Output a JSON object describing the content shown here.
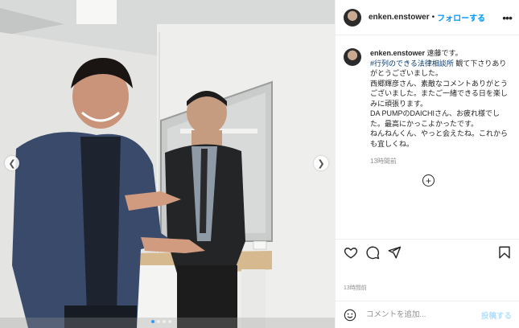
{
  "post": {
    "username": "enken.enstower",
    "separator": "•",
    "follow_label": "フォローする",
    "more_icon": "more-options-icon",
    "caption": {
      "username": "enken.enstower",
      "line1": "遠藤です。",
      "hashtag": "#行列のできる法律相談所",
      "line2": " 観て下さりありがとうございました。",
      "line3": "西郷輝彦さん、素敵なコメントありがとうございました。またご一緒できる日を楽しみに頑張ります。",
      "line4": "DA PUMPのDAICHIさん、お疲れ様でした。最高にかっこよかったです。",
      "line5": "ねんねんくん、やっと会えたね。これからも宜しくね。"
    },
    "caption_time": "13時間前",
    "posted_time": "13時間前",
    "comment_placeholder": "コメントを追加...",
    "post_label": "投稿する"
  },
  "carousel": {
    "count": 4,
    "active_index": 0
  },
  "colors": {
    "accent": "#0095f6",
    "link": "#00376b",
    "muted": "#8e8e8e"
  }
}
